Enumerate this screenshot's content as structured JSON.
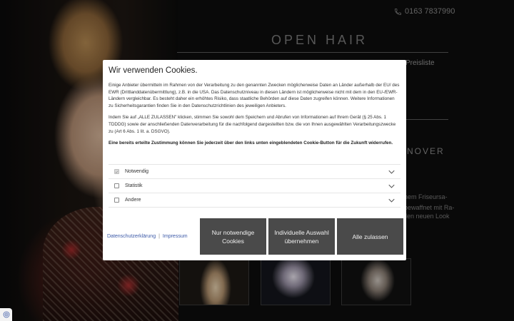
{
  "site": {
    "phone": "0163 7837990",
    "brand": "OPEN HAIR",
    "nav_partial": "Preisliste",
    "heading_partial": "NOVER",
    "text_lines": [
      "nem Friseursa-",
      "bewaffnet mit Ra-",
      "llen neuen Look"
    ]
  },
  "cookie_banner": {
    "title": "Wir verwenden Cookies.",
    "paragraph_1": "Einige Anbieter übermitteln im Rahmen von der Verarbeitung zu den genannten Zwecken möglicherweise Daten an Länder außerhalb der EU/ des EWR (Drittlanddatenübermittlung), z.B. in die USA. Das Datenschutzniveau in diesen Ländern ist möglicherweise nicht mit dem in den EU-/EWR-Ländern vergleichbar. Es besteht daher ein erhöhtes Risiko, dass staatliche Behörden auf diese Daten zugreifen können. Weitere Informationen zu Sicherheitsgarantien finden Sie in den Datenschutzrichtlinien des jeweiligen Anbieters.",
    "paragraph_2": "Indem Sie auf „ALLE ZULASSEN\" klicken, stimmen Sie sowohl dem Speichern und Abrufen von Informationen auf Ihrem Gerät (§ 25 Abs. 1 TDDDG) sowie der anschließenden Datenverarbeitung für die nachfolgend dargestellten bzw. die von Ihnen ausgewählten Verarbeitungszwecke zu (Art 6 Abs. 1 lit. a. DSGVO).",
    "paragraph_3": "Eine bereits erteilte Zustimmung können Sie jederzeit über den links unten eingeblendeten Cookie-Button für die Zukunft widerrufen.",
    "categories": [
      {
        "label": "Notwendig",
        "checked": true
      },
      {
        "label": "Statistik",
        "checked": false
      },
      {
        "label": "Andere",
        "checked": false
      }
    ],
    "links": {
      "privacy": "Datenschutzerklärung",
      "separator": "|",
      "imprint": "Impressum"
    },
    "buttons": {
      "necessary_only": "Nur notwendige Cookies",
      "individual": "Individuelle Auswahl übernehmen",
      "accept_all": "Alle zulassen"
    }
  },
  "colors": {
    "button_bg": "#4a4a4a",
    "link": "#3d5aa8",
    "page_bg": "#0d0d0d"
  }
}
